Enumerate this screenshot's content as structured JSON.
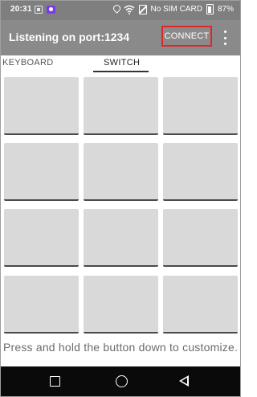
{
  "status_bar": {
    "time": "20:31",
    "no_sim": "No SIM CARD",
    "battery": "87%",
    "icons": [
      "screenshot-icon",
      "app-icon",
      "location-icon",
      "wifi-icon",
      "no-sim-icon",
      "battery-icon"
    ]
  },
  "app_bar": {
    "title": "Listening on port:1234",
    "connect_label": "CONNECT",
    "overflow_icon": "more-vert-icon",
    "highlight_color": "#e02626"
  },
  "tabs": [
    {
      "label": "KEYBOARD",
      "selected": false
    },
    {
      "label": "SWITCH",
      "selected": true
    }
  ],
  "switch_grid": {
    "rows": 4,
    "columns": 3,
    "buttons": [
      "",
      "",
      "",
      "",
      "",
      "",
      "",
      "",
      "",
      "",
      "",
      ""
    ]
  },
  "hint": "Press and hold the button down to customize.",
  "nav_bar": {
    "icons": [
      "recent-apps-icon",
      "home-icon",
      "back-icon"
    ]
  }
}
